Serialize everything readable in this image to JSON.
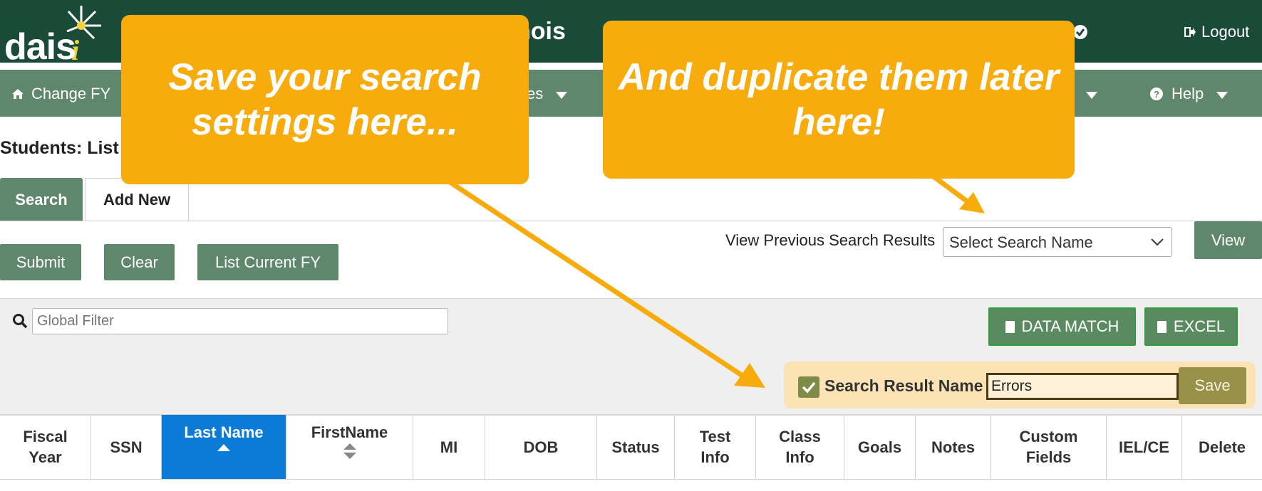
{
  "header": {
    "logo_text": "dais",
    "title_fragment": "nois",
    "logout_label": "Logout"
  },
  "nav": {
    "change_fy": "Change FY",
    "classes_fragment": "ses",
    "admin_fragment": "n",
    "help": "Help"
  },
  "page_title": "Students: List",
  "tabs": {
    "search": "Search",
    "add_new": "Add New"
  },
  "actions": {
    "submit": "Submit",
    "clear": "Clear",
    "list_current_fy": "List Current FY",
    "view_previous_label": "View Previous Search Results",
    "select_placeholder": "Select Search Name",
    "view": "View"
  },
  "filter": {
    "global_placeholder": "Global Filter",
    "data_match": "DATA MATCH",
    "excel": "EXCEL",
    "search_result_name_label": "Search Result Name",
    "search_result_name_value": "Errors",
    "save": "Save"
  },
  "table": {
    "headers": [
      {
        "line1": "Fiscal",
        "line2": "Year"
      },
      {
        "line1": "SSN",
        "line2": ""
      },
      {
        "line1": "Last Name",
        "line2": ""
      },
      {
        "line1": "FirstName",
        "line2": ""
      },
      {
        "line1": "MI",
        "line2": ""
      },
      {
        "line1": "DOB",
        "line2": ""
      },
      {
        "line1": "Status",
        "line2": ""
      },
      {
        "line1": "Test",
        "line2": "Info"
      },
      {
        "line1": "Class",
        "line2": "Info"
      },
      {
        "line1": "Goals",
        "line2": ""
      },
      {
        "line1": "Notes",
        "line2": ""
      },
      {
        "line1": "Custom",
        "line2": "Fields"
      },
      {
        "line1": "IEL/CE",
        "line2": ""
      },
      {
        "line1": "Delete",
        "line2": ""
      }
    ]
  },
  "callouts": {
    "left": "Save your search settings here...",
    "right": "And duplicate them later here!"
  },
  "colors": {
    "header_bg": "#1a4a38",
    "nav_bg": "#5f876b",
    "callout": "#f7ab0c",
    "active_sort": "#0a7bd6",
    "save_panel": "#fce3b6"
  },
  "icons": [
    "home-icon",
    "help-circle-icon",
    "logout-icon",
    "search-icon",
    "chevron-down-icon",
    "file-excel-icon",
    "checkbox-checked-icon",
    "sort-asc-icon",
    "sort-both-icon"
  ]
}
